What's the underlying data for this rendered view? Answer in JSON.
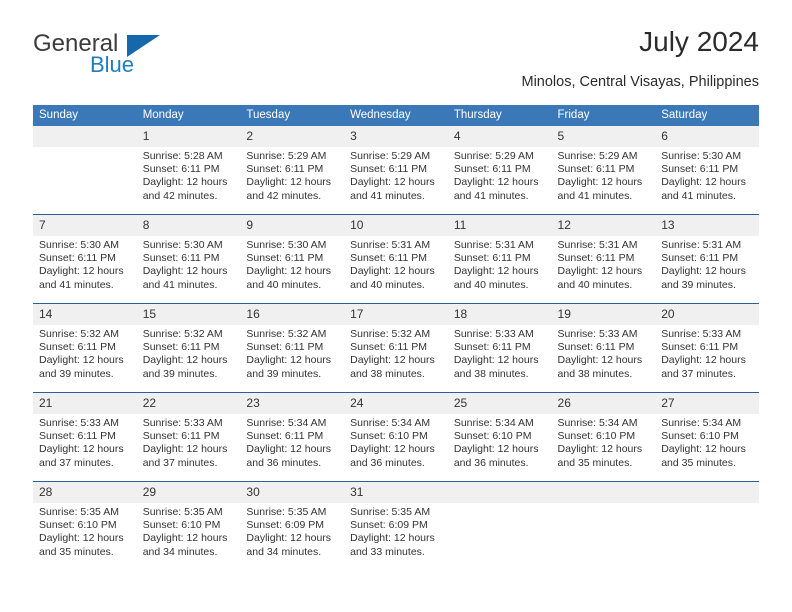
{
  "brand": {
    "name_part1": "General",
    "name_part2": "Blue",
    "logo_icon": "triangle-flag-icon"
  },
  "header": {
    "title": "July 2024",
    "subtitle": "Minolos, Central Visayas, Philippines"
  },
  "colors": {
    "header_blue": "#3b78b8",
    "row_divider_blue": "#2a6099",
    "daynum_band": "#f0f0f0",
    "brand_blue": "#1f7ec1",
    "text": "#333333"
  },
  "weekday_headers": [
    "Sunday",
    "Monday",
    "Tuesday",
    "Wednesday",
    "Thursday",
    "Friday",
    "Saturday"
  ],
  "weeks": [
    [
      {
        "day": "",
        "sunrise": "",
        "sunset": "",
        "daylight1": "",
        "daylight2": "",
        "empty": true
      },
      {
        "day": "1",
        "sunrise": "Sunrise: 5:28 AM",
        "sunset": "Sunset: 6:11 PM",
        "daylight1": "Daylight: 12 hours",
        "daylight2": "and 42 minutes.",
        "empty": false
      },
      {
        "day": "2",
        "sunrise": "Sunrise: 5:29 AM",
        "sunset": "Sunset: 6:11 PM",
        "daylight1": "Daylight: 12 hours",
        "daylight2": "and 42 minutes.",
        "empty": false
      },
      {
        "day": "3",
        "sunrise": "Sunrise: 5:29 AM",
        "sunset": "Sunset: 6:11 PM",
        "daylight1": "Daylight: 12 hours",
        "daylight2": "and 41 minutes.",
        "empty": false
      },
      {
        "day": "4",
        "sunrise": "Sunrise: 5:29 AM",
        "sunset": "Sunset: 6:11 PM",
        "daylight1": "Daylight: 12 hours",
        "daylight2": "and 41 minutes.",
        "empty": false
      },
      {
        "day": "5",
        "sunrise": "Sunrise: 5:29 AM",
        "sunset": "Sunset: 6:11 PM",
        "daylight1": "Daylight: 12 hours",
        "daylight2": "and 41 minutes.",
        "empty": false
      },
      {
        "day": "6",
        "sunrise": "Sunrise: 5:30 AM",
        "sunset": "Sunset: 6:11 PM",
        "daylight1": "Daylight: 12 hours",
        "daylight2": "and 41 minutes.",
        "empty": false
      }
    ],
    [
      {
        "day": "7",
        "sunrise": "Sunrise: 5:30 AM",
        "sunset": "Sunset: 6:11 PM",
        "daylight1": "Daylight: 12 hours",
        "daylight2": "and 41 minutes.",
        "empty": false
      },
      {
        "day": "8",
        "sunrise": "Sunrise: 5:30 AM",
        "sunset": "Sunset: 6:11 PM",
        "daylight1": "Daylight: 12 hours",
        "daylight2": "and 41 minutes.",
        "empty": false
      },
      {
        "day": "9",
        "sunrise": "Sunrise: 5:30 AM",
        "sunset": "Sunset: 6:11 PM",
        "daylight1": "Daylight: 12 hours",
        "daylight2": "and 40 minutes.",
        "empty": false
      },
      {
        "day": "10",
        "sunrise": "Sunrise: 5:31 AM",
        "sunset": "Sunset: 6:11 PM",
        "daylight1": "Daylight: 12 hours",
        "daylight2": "and 40 minutes.",
        "empty": false
      },
      {
        "day": "11",
        "sunrise": "Sunrise: 5:31 AM",
        "sunset": "Sunset: 6:11 PM",
        "daylight1": "Daylight: 12 hours",
        "daylight2": "and 40 minutes.",
        "empty": false
      },
      {
        "day": "12",
        "sunrise": "Sunrise: 5:31 AM",
        "sunset": "Sunset: 6:11 PM",
        "daylight1": "Daylight: 12 hours",
        "daylight2": "and 40 minutes.",
        "empty": false
      },
      {
        "day": "13",
        "sunrise": "Sunrise: 5:31 AM",
        "sunset": "Sunset: 6:11 PM",
        "daylight1": "Daylight: 12 hours",
        "daylight2": "and 39 minutes.",
        "empty": false
      }
    ],
    [
      {
        "day": "14",
        "sunrise": "Sunrise: 5:32 AM",
        "sunset": "Sunset: 6:11 PM",
        "daylight1": "Daylight: 12 hours",
        "daylight2": "and 39 minutes.",
        "empty": false
      },
      {
        "day": "15",
        "sunrise": "Sunrise: 5:32 AM",
        "sunset": "Sunset: 6:11 PM",
        "daylight1": "Daylight: 12 hours",
        "daylight2": "and 39 minutes.",
        "empty": false
      },
      {
        "day": "16",
        "sunrise": "Sunrise: 5:32 AM",
        "sunset": "Sunset: 6:11 PM",
        "daylight1": "Daylight: 12 hours",
        "daylight2": "and 39 minutes.",
        "empty": false
      },
      {
        "day": "17",
        "sunrise": "Sunrise: 5:32 AM",
        "sunset": "Sunset: 6:11 PM",
        "daylight1": "Daylight: 12 hours",
        "daylight2": "and 38 minutes.",
        "empty": false
      },
      {
        "day": "18",
        "sunrise": "Sunrise: 5:33 AM",
        "sunset": "Sunset: 6:11 PM",
        "daylight1": "Daylight: 12 hours",
        "daylight2": "and 38 minutes.",
        "empty": false
      },
      {
        "day": "19",
        "sunrise": "Sunrise: 5:33 AM",
        "sunset": "Sunset: 6:11 PM",
        "daylight1": "Daylight: 12 hours",
        "daylight2": "and 38 minutes.",
        "empty": false
      },
      {
        "day": "20",
        "sunrise": "Sunrise: 5:33 AM",
        "sunset": "Sunset: 6:11 PM",
        "daylight1": "Daylight: 12 hours",
        "daylight2": "and 37 minutes.",
        "empty": false
      }
    ],
    [
      {
        "day": "21",
        "sunrise": "Sunrise: 5:33 AM",
        "sunset": "Sunset: 6:11 PM",
        "daylight1": "Daylight: 12 hours",
        "daylight2": "and 37 minutes.",
        "empty": false
      },
      {
        "day": "22",
        "sunrise": "Sunrise: 5:33 AM",
        "sunset": "Sunset: 6:11 PM",
        "daylight1": "Daylight: 12 hours",
        "daylight2": "and 37 minutes.",
        "empty": false
      },
      {
        "day": "23",
        "sunrise": "Sunrise: 5:34 AM",
        "sunset": "Sunset: 6:11 PM",
        "daylight1": "Daylight: 12 hours",
        "daylight2": "and 36 minutes.",
        "empty": false
      },
      {
        "day": "24",
        "sunrise": "Sunrise: 5:34 AM",
        "sunset": "Sunset: 6:10 PM",
        "daylight1": "Daylight: 12 hours",
        "daylight2": "and 36 minutes.",
        "empty": false
      },
      {
        "day": "25",
        "sunrise": "Sunrise: 5:34 AM",
        "sunset": "Sunset: 6:10 PM",
        "daylight1": "Daylight: 12 hours",
        "daylight2": "and 36 minutes.",
        "empty": false
      },
      {
        "day": "26",
        "sunrise": "Sunrise: 5:34 AM",
        "sunset": "Sunset: 6:10 PM",
        "daylight1": "Daylight: 12 hours",
        "daylight2": "and 35 minutes.",
        "empty": false
      },
      {
        "day": "27",
        "sunrise": "Sunrise: 5:34 AM",
        "sunset": "Sunset: 6:10 PM",
        "daylight1": "Daylight: 12 hours",
        "daylight2": "and 35 minutes.",
        "empty": false
      }
    ],
    [
      {
        "day": "28",
        "sunrise": "Sunrise: 5:35 AM",
        "sunset": "Sunset: 6:10 PM",
        "daylight1": "Daylight: 12 hours",
        "daylight2": "and 35 minutes.",
        "empty": false
      },
      {
        "day": "29",
        "sunrise": "Sunrise: 5:35 AM",
        "sunset": "Sunset: 6:10 PM",
        "daylight1": "Daylight: 12 hours",
        "daylight2": "and 34 minutes.",
        "empty": false
      },
      {
        "day": "30",
        "sunrise": "Sunrise: 5:35 AM",
        "sunset": "Sunset: 6:09 PM",
        "daylight1": "Daylight: 12 hours",
        "daylight2": "and 34 minutes.",
        "empty": false
      },
      {
        "day": "31",
        "sunrise": "Sunrise: 5:35 AM",
        "sunset": "Sunset: 6:09 PM",
        "daylight1": "Daylight: 12 hours",
        "daylight2": "and 33 minutes.",
        "empty": false
      },
      {
        "day": "",
        "sunrise": "",
        "sunset": "",
        "daylight1": "",
        "daylight2": "",
        "empty": true
      },
      {
        "day": "",
        "sunrise": "",
        "sunset": "",
        "daylight1": "",
        "daylight2": "",
        "empty": true
      },
      {
        "day": "",
        "sunrise": "",
        "sunset": "",
        "daylight1": "",
        "daylight2": "",
        "empty": true
      }
    ]
  ]
}
